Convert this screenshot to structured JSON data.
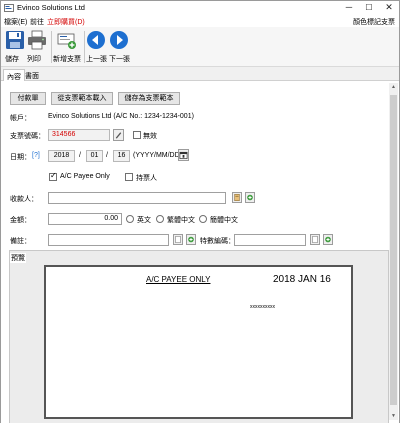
{
  "window": {
    "title": "Evinco Solutions Ltd",
    "minimize": "─",
    "maximize": "☐",
    "close": "✕"
  },
  "menu": {
    "file": "檔案(E)",
    "goto": "前往",
    "reprint": "立即購買(D)",
    "right": "顏色標記支票"
  },
  "toolbar": {
    "save": "儲存",
    "print": "列印",
    "new_cheque": "新增支票",
    "prev": "上一張",
    "next": "下一張"
  },
  "tabs": {
    "content": "內容",
    "page": "書面"
  },
  "form": {
    "btn_payment": "付款單",
    "btn_load_template": "從支票範本載入",
    "btn_save_template": "儲存為支票範本",
    "account_label": "帳戶：",
    "account_value": "Evinco Solutions Ltd (A/C No.: 1234-1234-001)",
    "cheque_no_label": "支票號碼：",
    "cheque_no_value": "314566",
    "void_label": "無效",
    "date_label": "日期：",
    "date_help": "[?]",
    "date_year": "2018",
    "date_sep": "/",
    "date_month": "01",
    "date_day": "16",
    "date_format": "(YYYY/MM/DD)",
    "payee_only_label": "A/C Payee Only",
    "bearer_label": "持票人",
    "payee_label": "收款人：",
    "payee_value": "",
    "amount_label": "金額：",
    "amount_value": "0.00",
    "lang_english": "英文",
    "lang_trad": "繁體中文",
    "lang_simp": "簡體中文",
    "memo_label": "備註：",
    "memo_value": "",
    "ref_label": "特數編碼：",
    "ref_value": "",
    "preview_label": "預覽"
  },
  "preview": {
    "payee_only": "A/C PAYEE ONLY",
    "date": "2018 JAN 16",
    "amount_placeholder": "xxxxxxxxxx"
  },
  "state": {
    "void_checked": false,
    "payee_only_checked": true,
    "bearer_checked": false
  },
  "colors": {
    "cheque_no": "#d40000",
    "reprint_menu": "#d40000",
    "nav_blue": "#1e6fd0",
    "save_blue": "#2a5fa8"
  }
}
